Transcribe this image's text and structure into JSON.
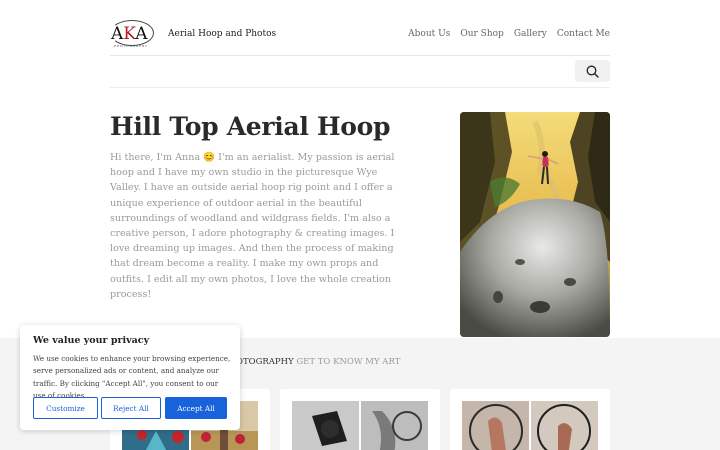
{
  "header": {
    "logo_text_a": "A",
    "logo_text_k": "K",
    "logo_text_a2": "A",
    "logo_sub": "PHOTOGRAPHY",
    "site_title": "Aerial Hoop and Photos",
    "nav": [
      "About Us",
      "Our Shop",
      "Gallery",
      "Contact Me"
    ]
  },
  "search": {
    "icon": "search-icon"
  },
  "hero": {
    "title": "Hill Top Aerial Hoop",
    "text": "Hi there, I'm Anna 😊 I'm an aerialist. My passion is aerial hoop and I have my own studio in the picturesque Wye Valley. I have an outside aerial hoop rig point and I offer a unique experience of outdoor aerial in the beautiful surroundings of woodland and wildgrass fields. I'm also a creative person, I adore photography & creating images. I love dreaming up images. And then the process of making that dream become a reality. I make my own props and outfits. I edit all my own photos, I love the whole creation process!"
  },
  "gallery": {
    "heading_dark": "OTOGRAPHY",
    "heading_light": "GET TO KNOW MY ART"
  },
  "cookie": {
    "title": "We value your privacy",
    "text": "We use cookies to enhance your browsing experience, serve personalized ads or content, and analyze our traffic. By clicking \"Accept All\", you consent to our use of cookies.",
    "customize": "Customize",
    "reject": "Reject All",
    "accept": "Accept All"
  },
  "colors": {
    "accent_blue": "#1863dc",
    "logo_red": "#b01e2a"
  }
}
